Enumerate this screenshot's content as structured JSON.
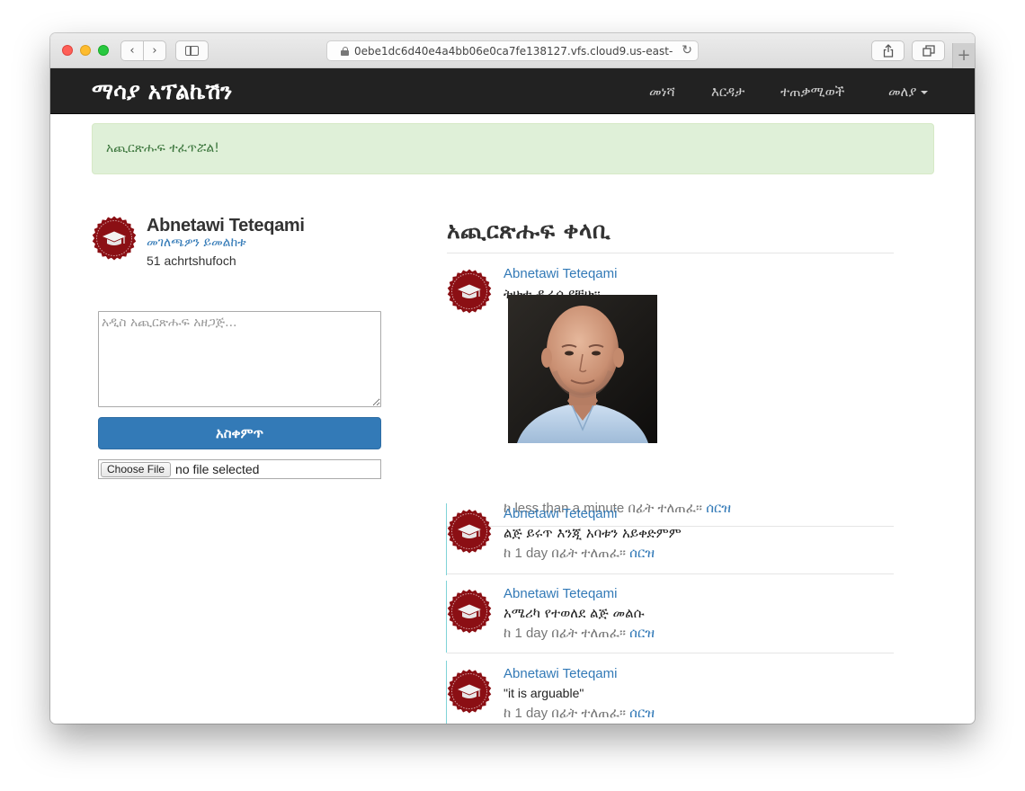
{
  "browser": {
    "url": "0ebe1dc6d40e4a4bb06e0ca7fe138127.vfs.cloud9.us-east-",
    "back_glyph": "‹",
    "forward_glyph": "›",
    "reload_glyph": "↻",
    "new_tab_glyph": "+"
  },
  "navbar": {
    "brand": "ማሳያ አፕልኬሽን",
    "links": [
      "መነሻ",
      "እርዳታ",
      "ተጠቃሚወች",
      "መለያ"
    ]
  },
  "alert": {
    "message": "አጪርጽሑፍ ተፈጥሯል!"
  },
  "sidebar": {
    "user_name": "Abnetawi Teteqami",
    "profile_link": "መገለጫዎን ይመልከቱ",
    "micropost_count": "51 achrtshufoch",
    "compose_placeholder": "አዲስ አጪርጽሑፍ አዘጋጅ...",
    "post_button": "አስቀምጥ",
    "choose_file": "Choose File",
    "no_file": "no file selected"
  },
  "feed": {
    "title": "አጪርጽሑፍ ቀላቢ",
    "delete_label": "ሰርዝ",
    "posts": [
      {
        "author": "Abnetawi Teteqami",
        "content": "ትሁቱ ዷራሲያቹሁ።",
        "time": "ከ less than a minute በፊት ተለጠፈ።",
        "has_image": true
      },
      {
        "author": "Abnetawi Teteqami",
        "content": "ልጅ ይሩጥ እንጂ አባቱን አይቀድምም",
        "time": "ከ 1 day በፊት ተለጠፈ።",
        "has_image": false
      },
      {
        "author": "Abnetawi Teteqami",
        "content": "አሜሪካ የተወለደ ልጅ መልሱ",
        "time": "ከ 1 day በፊት ተለጠፈ።",
        "has_image": false
      },
      {
        "author": "Abnetawi Teteqami",
        "content": "\"it is arguable\"",
        "time": "ከ 1 day በፊት ተለጠፈ።",
        "has_image": false
      }
    ]
  },
  "colors": {
    "navbar_bg": "#222222",
    "link": "#337ab7",
    "alert_bg": "#dff0d8",
    "alert_text": "#3c763d",
    "avatar_red": "#8b0f14"
  }
}
